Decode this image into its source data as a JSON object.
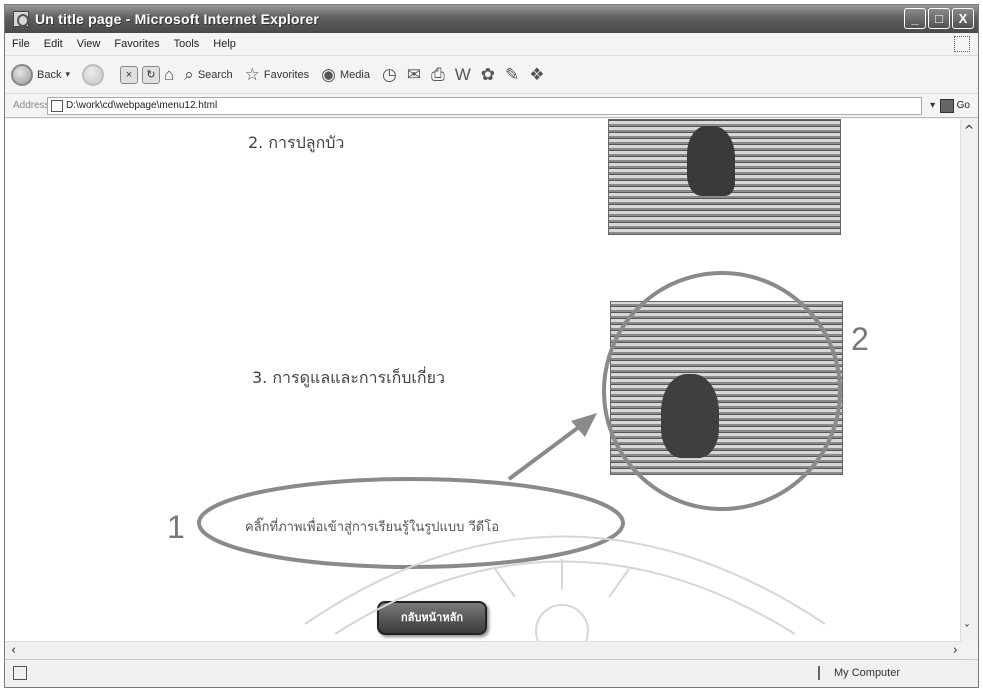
{
  "window": {
    "title": "Un title page - Microsoft Internet Explorer",
    "controls": {
      "minimize": "_",
      "maximize": "□",
      "close": "X"
    }
  },
  "menu": [
    "File",
    "Edit",
    "View",
    "Favorites",
    "Tools",
    "Help"
  ],
  "toolbar": {
    "back": "Back",
    "search": "Search",
    "favorites": "Favorites",
    "media": "Media"
  },
  "address": {
    "label": "Address",
    "url": "D:\\work\\cd\\webpage\\menu12.html",
    "go": "Go"
  },
  "content": {
    "items": [
      {
        "label": "2. การปลูกบัว"
      },
      {
        "label": "3. การดูแลและการเก็บเกี่ยว"
      }
    ],
    "callout_text": "คลิ๊กที่ภาพเพื่อเข้าสู่การเรียนรู้ในรูปแบบ วีดีโอ",
    "annotation_1": "1",
    "annotation_2": "2",
    "back_button": "กลับหน้าหลัก"
  },
  "status": {
    "zone": "My Computer"
  },
  "colors": {
    "annotation": "#8a8a8a",
    "titlebar": "#5a5a5a"
  }
}
